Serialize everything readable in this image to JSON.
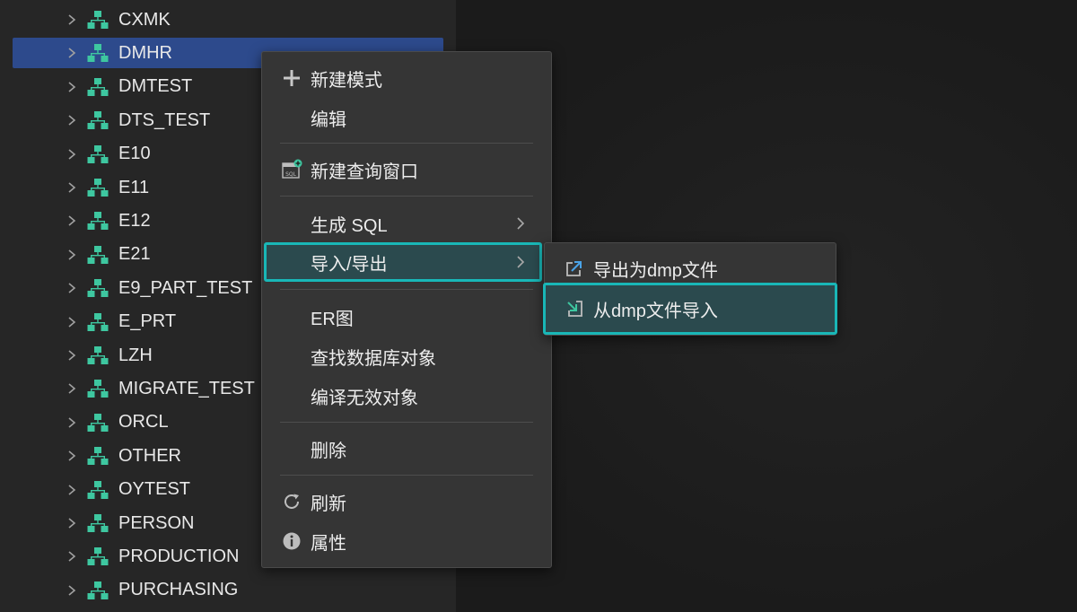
{
  "tree": {
    "items": [
      {
        "label": "CXMK"
      },
      {
        "label": "DMHR",
        "selected": true
      },
      {
        "label": "DMTEST"
      },
      {
        "label": "DTS_TEST"
      },
      {
        "label": "E10"
      },
      {
        "label": "E11"
      },
      {
        "label": "E12"
      },
      {
        "label": "E21"
      },
      {
        "label": "E9_PART_TEST"
      },
      {
        "label": "E_PRT"
      },
      {
        "label": "LZH"
      },
      {
        "label": "MIGRATE_TEST"
      },
      {
        "label": "ORCL"
      },
      {
        "label": "OTHER"
      },
      {
        "label": "OYTEST"
      },
      {
        "label": "PERSON"
      },
      {
        "label": "PRODUCTION"
      },
      {
        "label": "PURCHASING"
      }
    ]
  },
  "context_menu": {
    "new_schema": "新建模式",
    "edit": "编辑",
    "new_query_window": "新建查询窗口",
    "sql_icon_text": "SQL",
    "generate_sql": "生成 SQL",
    "import_export": "导入/导出",
    "er_diagram": "ER图",
    "find_db_objects": "查找数据库对象",
    "compile_invalid": "编译无效对象",
    "delete": "删除",
    "refresh": "刷新",
    "properties": "属性"
  },
  "submenu": {
    "export_dmp": "导出为dmp文件",
    "import_dmp": "从dmp文件导入"
  },
  "colors": {
    "accent_highlight": "#19b7b7",
    "schema_icon": "#3ec7a0",
    "selection": "#2d4a8c"
  }
}
